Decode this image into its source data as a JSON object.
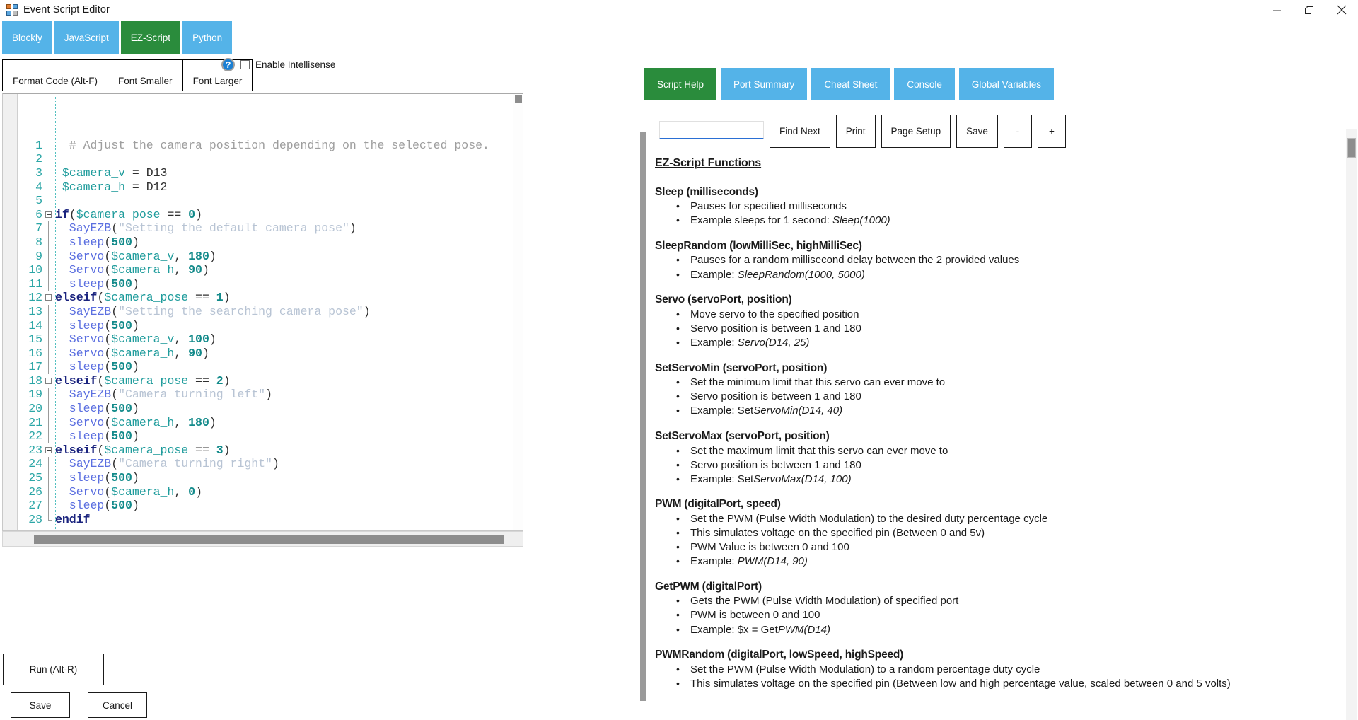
{
  "window": {
    "title": "Event Script Editor",
    "icon": "app-window-icon",
    "controls": {
      "minimize": "–",
      "restore": "❐",
      "close": "✕"
    }
  },
  "language_tabs": [
    {
      "label": "Blockly",
      "active": false
    },
    {
      "label": "JavaScript",
      "active": false
    },
    {
      "label": "EZ-Script",
      "active": true
    },
    {
      "label": "Python",
      "active": false
    }
  ],
  "format_toolbar": [
    {
      "label": "Format Code (Alt-F)"
    },
    {
      "label": "Font Smaller"
    },
    {
      "label": "Font Larger"
    }
  ],
  "intellisense": {
    "help_icon": "?",
    "checkbox_label": "Enable Intellisense",
    "checked": false
  },
  "editor": {
    "lines": [
      {
        "n": "1",
        "fold": "none",
        "tokens": [
          {
            "t": "  # Adjust the camera position depending on the selected pose.",
            "c": "tok-com"
          }
        ]
      },
      {
        "n": "2",
        "fold": "none",
        "tokens": []
      },
      {
        "n": "3",
        "fold": "none",
        "tokens": [
          {
            "t": " $camera_v",
            "c": "tok-var"
          },
          {
            "t": " = ",
            "c": "tok-plain"
          },
          {
            "t": "D13",
            "c": "tok-plain"
          }
        ]
      },
      {
        "n": "4",
        "fold": "none",
        "tokens": [
          {
            "t": " $camera_h",
            "c": "tok-var"
          },
          {
            "t": " = ",
            "c": "tok-plain"
          },
          {
            "t": "D12",
            "c": "tok-plain"
          }
        ]
      },
      {
        "n": "5",
        "fold": "none",
        "tokens": []
      },
      {
        "n": "6",
        "fold": "box",
        "tokens": [
          {
            "t": "if",
            "c": "tok-kw"
          },
          {
            "t": "(",
            "c": "tok-plain"
          },
          {
            "t": "$camera_pose",
            "c": "tok-var"
          },
          {
            "t": " == ",
            "c": "tok-plain"
          },
          {
            "t": "0",
            "c": "tok-num"
          },
          {
            "t": ")",
            "c": "tok-plain"
          }
        ]
      },
      {
        "n": "7",
        "fold": "line",
        "tokens": [
          {
            "t": "  SayEZB",
            "c": "tok-fn"
          },
          {
            "t": "(",
            "c": "tok-plain"
          },
          {
            "t": "\"Setting the default camera pose\"",
            "c": "tok-str"
          },
          {
            "t": ")",
            "c": "tok-plain"
          }
        ]
      },
      {
        "n": "8",
        "fold": "line",
        "tokens": [
          {
            "t": "  sleep",
            "c": "tok-fn"
          },
          {
            "t": "(",
            "c": "tok-plain"
          },
          {
            "t": "500",
            "c": "tok-num"
          },
          {
            "t": ")",
            "c": "tok-plain"
          }
        ]
      },
      {
        "n": "9",
        "fold": "line",
        "tokens": [
          {
            "t": "  Servo",
            "c": "tok-fn"
          },
          {
            "t": "(",
            "c": "tok-plain"
          },
          {
            "t": "$camera_v",
            "c": "tok-var"
          },
          {
            "t": ", ",
            "c": "tok-plain"
          },
          {
            "t": "180",
            "c": "tok-num"
          },
          {
            "t": ")",
            "c": "tok-plain"
          }
        ]
      },
      {
        "n": "10",
        "fold": "line",
        "tokens": [
          {
            "t": "  Servo",
            "c": "tok-fn"
          },
          {
            "t": "(",
            "c": "tok-plain"
          },
          {
            "t": "$camera_h",
            "c": "tok-var"
          },
          {
            "t": ", ",
            "c": "tok-plain"
          },
          {
            "t": "90",
            "c": "tok-num"
          },
          {
            "t": ")",
            "c": "tok-plain"
          }
        ]
      },
      {
        "n": "11",
        "fold": "line",
        "tokens": [
          {
            "t": "  sleep",
            "c": "tok-fn"
          },
          {
            "t": "(",
            "c": "tok-plain"
          },
          {
            "t": "500",
            "c": "tok-num"
          },
          {
            "t": ")",
            "c": "tok-plain"
          }
        ]
      },
      {
        "n": "12",
        "fold": "box",
        "tokens": [
          {
            "t": "elseif",
            "c": "tok-kw"
          },
          {
            "t": "(",
            "c": "tok-plain"
          },
          {
            "t": "$camera_pose",
            "c": "tok-var"
          },
          {
            "t": " == ",
            "c": "tok-plain"
          },
          {
            "t": "1",
            "c": "tok-num"
          },
          {
            "t": ")",
            "c": "tok-plain"
          }
        ]
      },
      {
        "n": "13",
        "fold": "line",
        "tokens": [
          {
            "t": "  SayEZB",
            "c": "tok-fn"
          },
          {
            "t": "(",
            "c": "tok-plain"
          },
          {
            "t": "\"Setting the searching camera pose\"",
            "c": "tok-str"
          },
          {
            "t": ")",
            "c": "tok-plain"
          }
        ]
      },
      {
        "n": "14",
        "fold": "line",
        "tokens": [
          {
            "t": "  sleep",
            "c": "tok-fn"
          },
          {
            "t": "(",
            "c": "tok-plain"
          },
          {
            "t": "500",
            "c": "tok-num"
          },
          {
            "t": ")",
            "c": "tok-plain"
          }
        ]
      },
      {
        "n": "15",
        "fold": "line",
        "tokens": [
          {
            "t": "  Servo",
            "c": "tok-fn"
          },
          {
            "t": "(",
            "c": "tok-plain"
          },
          {
            "t": "$camera_v",
            "c": "tok-var"
          },
          {
            "t": ", ",
            "c": "tok-plain"
          },
          {
            "t": "100",
            "c": "tok-num"
          },
          {
            "t": ")",
            "c": "tok-plain"
          }
        ]
      },
      {
        "n": "16",
        "fold": "line",
        "tokens": [
          {
            "t": "  Servo",
            "c": "tok-fn"
          },
          {
            "t": "(",
            "c": "tok-plain"
          },
          {
            "t": "$camera_h",
            "c": "tok-var"
          },
          {
            "t": ", ",
            "c": "tok-plain"
          },
          {
            "t": "90",
            "c": "tok-num"
          },
          {
            "t": ")",
            "c": "tok-plain"
          }
        ]
      },
      {
        "n": "17",
        "fold": "line",
        "tokens": [
          {
            "t": "  sleep",
            "c": "tok-fn"
          },
          {
            "t": "(",
            "c": "tok-plain"
          },
          {
            "t": "500",
            "c": "tok-num"
          },
          {
            "t": ")",
            "c": "tok-plain"
          }
        ]
      },
      {
        "n": "18",
        "fold": "box",
        "tokens": [
          {
            "t": "elseif",
            "c": "tok-kw"
          },
          {
            "t": "(",
            "c": "tok-plain"
          },
          {
            "t": "$camera_pose",
            "c": "tok-var"
          },
          {
            "t": " == ",
            "c": "tok-plain"
          },
          {
            "t": "2",
            "c": "tok-num"
          },
          {
            "t": ")",
            "c": "tok-plain"
          }
        ]
      },
      {
        "n": "19",
        "fold": "line",
        "tokens": [
          {
            "t": "  SayEZB",
            "c": "tok-fn"
          },
          {
            "t": "(",
            "c": "tok-plain"
          },
          {
            "t": "\"Camera turning left\"",
            "c": "tok-str"
          },
          {
            "t": ")",
            "c": "tok-plain"
          }
        ]
      },
      {
        "n": "20",
        "fold": "line",
        "tokens": [
          {
            "t": "  sleep",
            "c": "tok-fn"
          },
          {
            "t": "(",
            "c": "tok-plain"
          },
          {
            "t": "500",
            "c": "tok-num"
          },
          {
            "t": ")",
            "c": "tok-plain"
          }
        ]
      },
      {
        "n": "21",
        "fold": "line",
        "tokens": [
          {
            "t": "  Servo",
            "c": "tok-fn"
          },
          {
            "t": "(",
            "c": "tok-plain"
          },
          {
            "t": "$camera_h",
            "c": "tok-var"
          },
          {
            "t": ", ",
            "c": "tok-plain"
          },
          {
            "t": "180",
            "c": "tok-num"
          },
          {
            "t": ")",
            "c": "tok-plain"
          }
        ]
      },
      {
        "n": "22",
        "fold": "line",
        "tokens": [
          {
            "t": "  sleep",
            "c": "tok-fn"
          },
          {
            "t": "(",
            "c": "tok-plain"
          },
          {
            "t": "500",
            "c": "tok-num"
          },
          {
            "t": ")",
            "c": "tok-plain"
          }
        ]
      },
      {
        "n": "23",
        "fold": "box",
        "tokens": [
          {
            "t": "elseif",
            "c": "tok-kw"
          },
          {
            "t": "(",
            "c": "tok-plain"
          },
          {
            "t": "$camera_pose",
            "c": "tok-var"
          },
          {
            "t": " == ",
            "c": "tok-plain"
          },
          {
            "t": "3",
            "c": "tok-num"
          },
          {
            "t": ")",
            "c": "tok-plain"
          }
        ]
      },
      {
        "n": "24",
        "fold": "line",
        "tokens": [
          {
            "t": "  SayEZB",
            "c": "tok-fn"
          },
          {
            "t": "(",
            "c": "tok-plain"
          },
          {
            "t": "\"Camera turning right\"",
            "c": "tok-str"
          },
          {
            "t": ")",
            "c": "tok-plain"
          }
        ]
      },
      {
        "n": "25",
        "fold": "line",
        "tokens": [
          {
            "t": "  sleep",
            "c": "tok-fn"
          },
          {
            "t": "(",
            "c": "tok-plain"
          },
          {
            "t": "500",
            "c": "tok-num"
          },
          {
            "t": ")",
            "c": "tok-plain"
          }
        ]
      },
      {
        "n": "26",
        "fold": "line",
        "tokens": [
          {
            "t": "  Servo",
            "c": "tok-fn"
          },
          {
            "t": "(",
            "c": "tok-plain"
          },
          {
            "t": "$camera_h",
            "c": "tok-var"
          },
          {
            "t": ", ",
            "c": "tok-plain"
          },
          {
            "t": "0",
            "c": "tok-num"
          },
          {
            "t": ")",
            "c": "tok-plain"
          }
        ]
      },
      {
        "n": "27",
        "fold": "line",
        "tokens": [
          {
            "t": "  sleep",
            "c": "tok-fn"
          },
          {
            "t": "(",
            "c": "tok-plain"
          },
          {
            "t": "500",
            "c": "tok-num"
          },
          {
            "t": ")",
            "c": "tok-plain"
          }
        ]
      },
      {
        "n": "28",
        "fold": "end",
        "tokens": [
          {
            "t": "endif",
            "c": "tok-kw"
          }
        ]
      }
    ]
  },
  "bottom_buttons": {
    "run": "Run (Alt-R)",
    "save": "Save",
    "cancel": "Cancel"
  },
  "panel_tabs": [
    {
      "label": "Script Help",
      "active": true
    },
    {
      "label": "Port Summary",
      "active": false
    },
    {
      "label": "Cheat Sheet",
      "active": false
    },
    {
      "label": "Console",
      "active": false
    },
    {
      "label": "Global Variables",
      "active": false
    }
  ],
  "find_toolbar": {
    "search_value": "",
    "search_placeholder": "",
    "buttons": [
      {
        "label": "Find Next",
        "small": false
      },
      {
        "label": "Print",
        "small": false
      },
      {
        "label": "Page Setup",
        "small": false
      },
      {
        "label": "Save",
        "small": false
      },
      {
        "label": "-",
        "small": true
      },
      {
        "label": "+",
        "small": true
      }
    ]
  },
  "help": {
    "title": "EZ-Script Functions",
    "functions": [
      {
        "name": "Sleep (milliseconds)",
        "items": [
          {
            "text": "Pauses for specified milliseconds"
          },
          {
            "text": "Example sleeps for 1 second: ",
            "em": "Sleep(1000)"
          }
        ]
      },
      {
        "name": "SleepRandom (lowMilliSec, highMilliSec)",
        "items": [
          {
            "text": "Pauses for a random millisecond delay between the 2 provided values"
          },
          {
            "text": "Example: ",
            "em": "SleepRandom(1000, 5000)"
          }
        ]
      },
      {
        "name": "Servo (servoPort, position)",
        "items": [
          {
            "text": "Move servo to the specified position"
          },
          {
            "text": "Servo position is between 1 and 180"
          },
          {
            "text": "Example: ",
            "em": "Servo(D14, 25)"
          }
        ]
      },
      {
        "name": "SetServoMin (servoPort, position)",
        "items": [
          {
            "text": "Set the minimum limit that this servo can ever move to"
          },
          {
            "text": "Servo position is between 1 and 180"
          },
          {
            "text": "Example: Set",
            "em": "ServoMin(D14, 40)"
          }
        ]
      },
      {
        "name": "SetServoMax (servoPort, position)",
        "items": [
          {
            "text": "Set the maximum limit that this servo can ever move to"
          },
          {
            "text": "Servo position is between 1 and 180"
          },
          {
            "text": "Example: Set",
            "em": "ServoMax(D14, 100)"
          }
        ]
      },
      {
        "name": "PWM (digitalPort, speed)",
        "items": [
          {
            "text": "Set the PWM (Pulse Width Modulation) to the desired duty percentage cycle"
          },
          {
            "text": "This simulates voltage on the specified pin (Between 0 and 5v)"
          },
          {
            "text": "PWM Value is between 0 and 100"
          },
          {
            "text": "Example: ",
            "em": "PWM(D14, 90)"
          }
        ]
      },
      {
        "name": "GetPWM (digitalPort)",
        "items": [
          {
            "text": "Gets the PWM (Pulse Width Modulation) of specified port"
          },
          {
            "text": "PWM is between 0 and 100"
          },
          {
            "text": "Example: $x = Get",
            "em": "PWM(D14)"
          }
        ]
      },
      {
        "name": "PWMRandom (digitalPort, lowSpeed, highSpeed)",
        "items": [
          {
            "text": "Set the PWM (Pulse Width Modulation) to a random percentage duty cycle"
          },
          {
            "text": "This simulates voltage on the specified pin (Between low and high percentage value, scaled between 0 and 5 volts)"
          }
        ]
      }
    ]
  },
  "colors": {
    "tab_blue": "#54b3e8",
    "tab_green": "#2a8c3c",
    "accent_underline": "#2a6fd4"
  }
}
